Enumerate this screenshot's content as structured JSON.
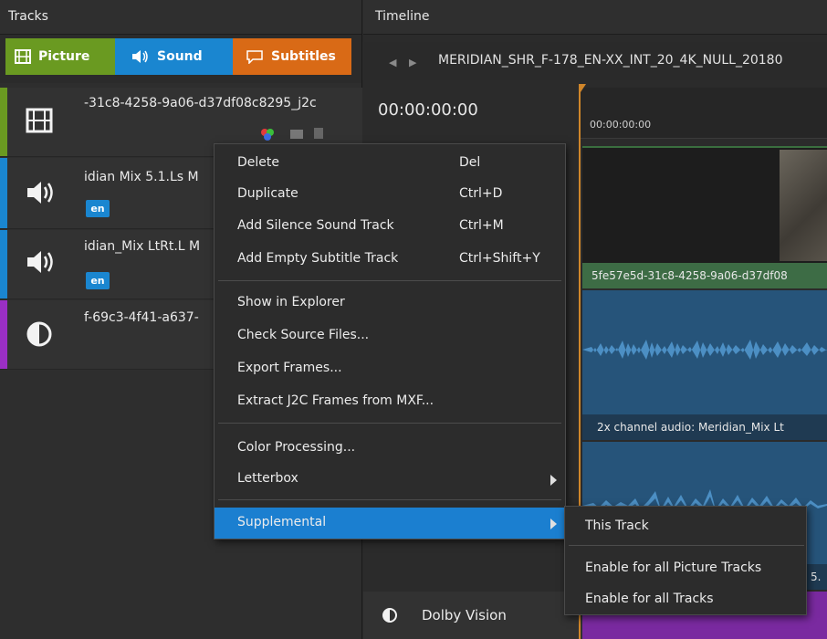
{
  "tracks_panel": {
    "title": "Tracks",
    "tabs": [
      {
        "label": "Picture",
        "icon": "film-icon",
        "color": "#6a9a21"
      },
      {
        "label": "Sound",
        "icon": "speaker-icon",
        "color": "#1a86d0"
      },
      {
        "label": "Subtitles",
        "icon": "subtitle-bubble-icon",
        "color": "#d96a16"
      }
    ],
    "tracks": [
      {
        "type": "picture",
        "name": "-31c8-4258-9a06-d37df08c8295_j2c",
        "strip_color": "#6a9a21"
      },
      {
        "type": "sound",
        "name": "idian Mix 5.1.Ls M",
        "lang": "en",
        "strip_color": "#1a86d0"
      },
      {
        "type": "sound",
        "name": "idian_Mix LtRt.L M",
        "lang": "en",
        "strip_color": "#1a86d0"
      },
      {
        "type": "dolby",
        "name": "f-69c3-4f41-a637-",
        "strip_color": "#9a2fc4"
      }
    ]
  },
  "timeline": {
    "title": "Timeline",
    "filename": "MERIDIAN_SHR_F-178_EN-XX_INT_20_4K_NULL_20180",
    "timecode": "00:00:00:00",
    "ruler_timecode": "00:00:00:00",
    "video_clip_label": "5fe57e5d-31c8-4258-9a06-d37df08",
    "audio_clip_label": "2x channel audio: Meridian_Mix Lt",
    "audio_clip2_label": "5.",
    "dolby_label": "Dolby Vision"
  },
  "context_menu": {
    "items": [
      {
        "label": "Delete",
        "shortcut": "Del"
      },
      {
        "label": "Duplicate",
        "shortcut": "Ctrl+D"
      },
      {
        "label": "Add Silence Sound Track",
        "shortcut": "Ctrl+M"
      },
      {
        "label": "Add Empty Subtitle Track",
        "shortcut": "Ctrl+Shift+Y"
      },
      {
        "label": "Show in Explorer"
      },
      {
        "label": "Check Source Files..."
      },
      {
        "label": "Export Frames..."
      },
      {
        "label": "Extract J2C Frames from MXF..."
      },
      {
        "label": "Color Processing..."
      },
      {
        "label": "Letterbox"
      },
      {
        "label": "Supplemental"
      }
    ]
  },
  "submenu": {
    "items": [
      {
        "label": "This Track"
      },
      {
        "label": "Enable for all Picture Tracks"
      },
      {
        "label": "Enable for all Tracks"
      }
    ]
  }
}
